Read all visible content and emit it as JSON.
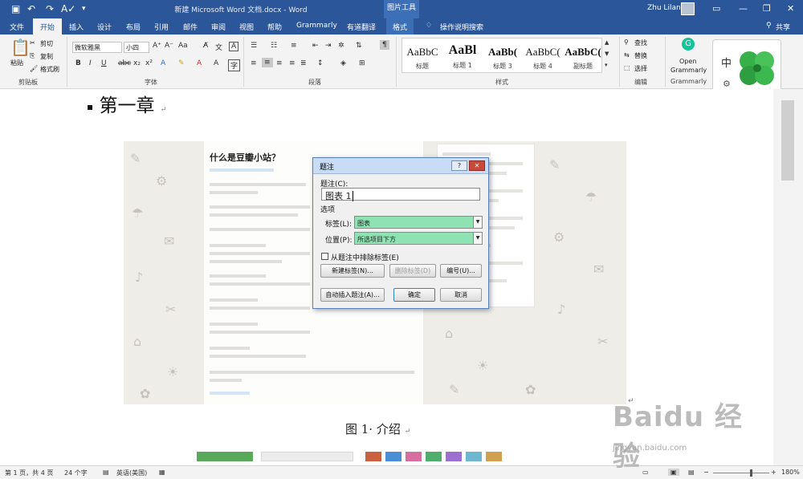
{
  "titlebar": {
    "doc_title": "新建 Microsoft Word 文档.docx - Word",
    "context_title": "图片工具",
    "user": "Zhu Lilan"
  },
  "tabs": [
    "文件",
    "开始",
    "插入",
    "设计",
    "布局",
    "引用",
    "邮件",
    "审阅",
    "视图",
    "帮助",
    "Grammarly",
    "有道翻译",
    "格式"
  ],
  "tell_me": "操作说明搜索",
  "share": "共享",
  "ribbon": {
    "clipboard": {
      "paste": "粘贴",
      "cut": "剪切",
      "copy": "复制",
      "format_painter": "格式刷",
      "label": "剪贴板"
    },
    "font": {
      "font_name": "微软雅黑",
      "font_size": "小四",
      "label": "字体"
    },
    "paragraph": {
      "label": "段落"
    },
    "styles": {
      "label": "样式",
      "items": [
        {
          "sample": "AaBbC",
          "name": "标题"
        },
        {
          "sample": "AaBl",
          "name": "标题 1"
        },
        {
          "sample": "AaBb(",
          "name": "标题 3"
        },
        {
          "sample": "AaBbC(",
          "name": "标题 4"
        },
        {
          "sample": "AaBbC(",
          "name": "副标题"
        }
      ]
    },
    "editing": {
      "find": "查找",
      "replace": "替换",
      "select": "选择",
      "label": "编辑"
    },
    "grammarly": {
      "open": "Open",
      "name": "Grammarly",
      "label": "Grammarly"
    }
  },
  "document": {
    "heading": "第一章",
    "caption": "图 1· 介绍",
    "web_title": "什么是豆瓣小站？"
  },
  "dialog": {
    "title": "题注",
    "help": "?",
    "close": "✕",
    "caption_label": "题注(C):",
    "caption_value": "图表  1",
    "options_label": "选项",
    "label_label": "标签(L):",
    "label_value": "图表",
    "position_label": "位置(P):",
    "position_value": "所选项目下方",
    "exclude_label": "从题注中排除标签(E)",
    "new_label_btn": "新建标签(N)...",
    "delete_label_btn": "删除标签(D)",
    "numbering_btn": "编号(U)...",
    "autocaption_btn": "自动插入题注(A)...",
    "ok_btn": "确定",
    "cancel_btn": "取消"
  },
  "statusbar": {
    "page": "第 1 页，共 4 页",
    "words": "24 个字",
    "language": "英语(美国)",
    "zoom": "180%"
  },
  "watermark": {
    "logo": "Baidu 经验",
    "url": "jingyan.baidu.com"
  },
  "colors": {
    "word_blue": "#2b579a",
    "combo_green": "#8fe3b3"
  }
}
